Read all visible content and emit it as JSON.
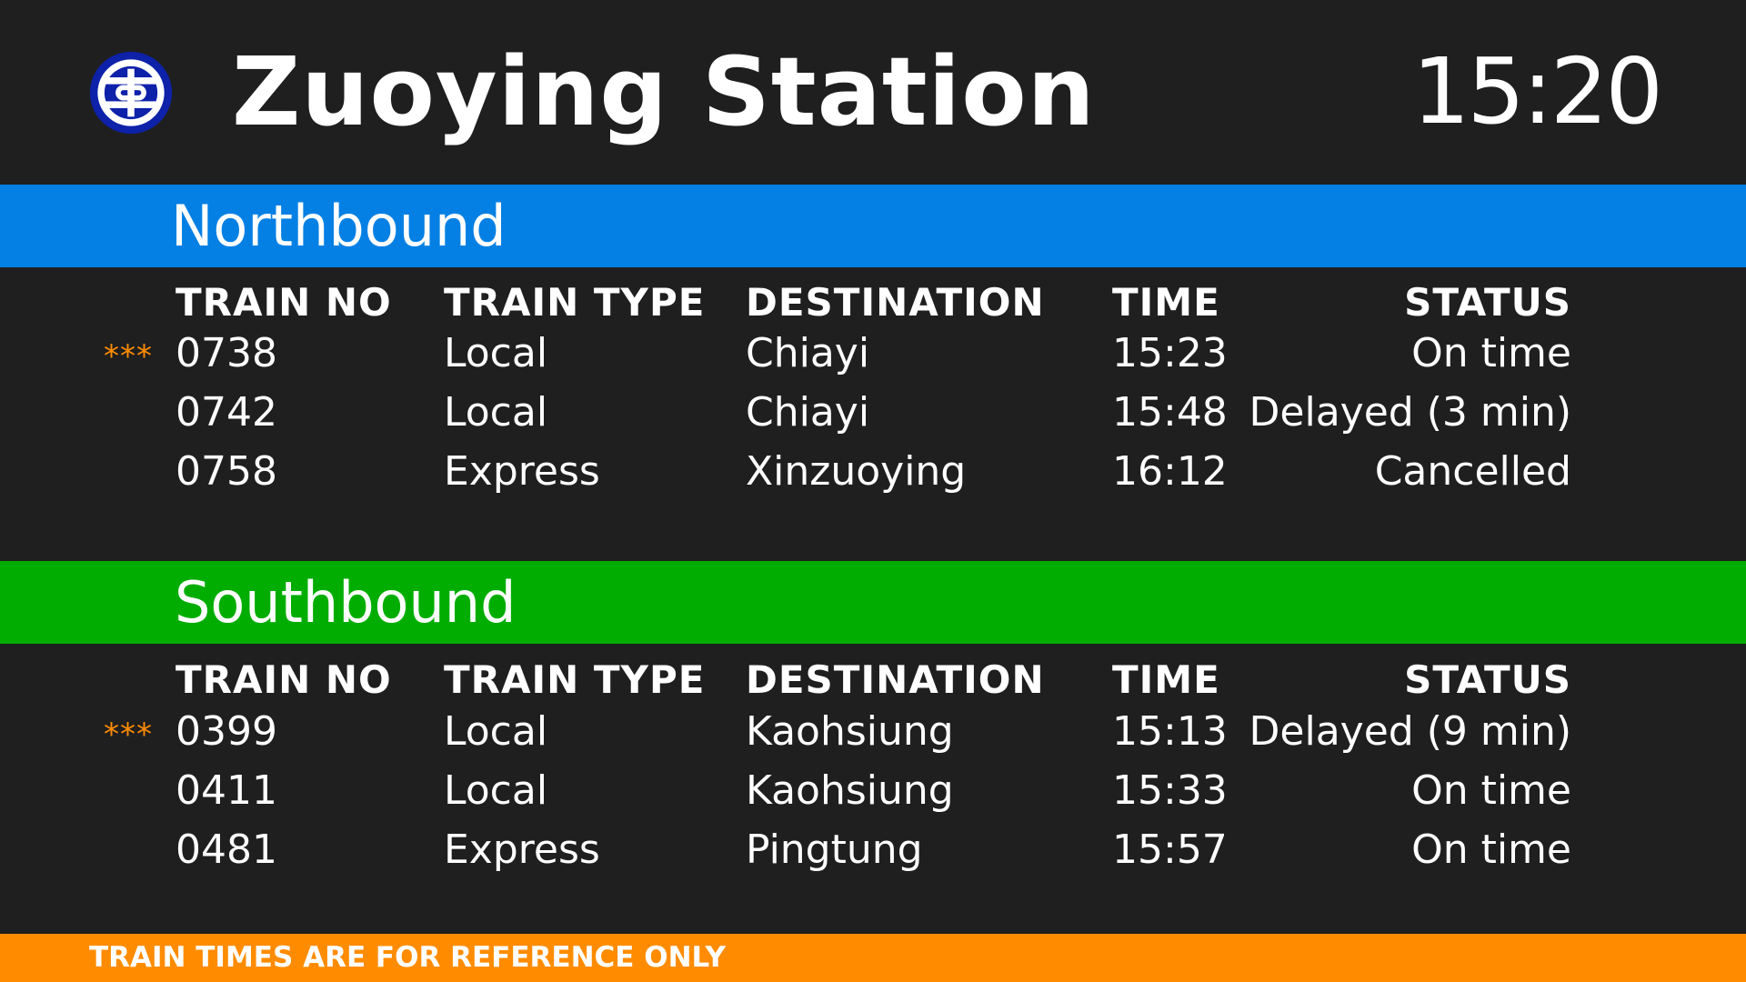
{
  "header": {
    "station_name": "Zuoying Station",
    "clock": "15:20",
    "logo_icon": "taiwan-railway-logo-icon"
  },
  "colors": {
    "background": "#1f1f1f",
    "northbound": "#0480e4",
    "southbound": "#02ad02",
    "footer": "#ff8c00",
    "marker": "#ff8c00",
    "logo": "#0d21a9"
  },
  "columns": {
    "train_no": "TRAIN NO",
    "train_type": "TRAIN TYPE",
    "destination": "DESTINATION",
    "time": "TIME",
    "status": "STATUS"
  },
  "northbound": {
    "title": "Northbound",
    "rows": [
      {
        "marker": "***",
        "train_no": "0738",
        "train_type": "Local",
        "destination": "Chiayi",
        "time": "15:23",
        "status": "On time"
      },
      {
        "marker": "",
        "train_no": "0742",
        "train_type": "Local",
        "destination": "Chiayi",
        "time": "15:48",
        "status": "Delayed (3 min)"
      },
      {
        "marker": "",
        "train_no": "0758",
        "train_type": "Express",
        "destination": "Xinzuoying",
        "time": "16:12",
        "status": "Cancelled"
      }
    ]
  },
  "southbound": {
    "title": "Southbound",
    "rows": [
      {
        "marker": "***",
        "train_no": "0399",
        "train_type": "Local",
        "destination": "Kaohsiung",
        "time": "15:13",
        "status": "Delayed (9 min)"
      },
      {
        "marker": "",
        "train_no": "0411",
        "train_type": "Local",
        "destination": "Kaohsiung",
        "time": "15:33",
        "status": "On time"
      },
      {
        "marker": "",
        "train_no": "0481",
        "train_type": "Express",
        "destination": "Pingtung",
        "time": "15:57",
        "status": "On time"
      }
    ]
  },
  "footer": {
    "note": "TRAIN TIMES ARE FOR REFERENCE ONLY"
  }
}
